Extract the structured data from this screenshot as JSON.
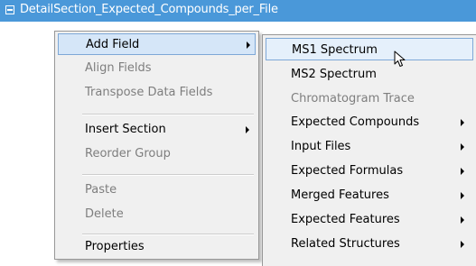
{
  "section": {
    "title": "DetailSection_Expected_Compounds_per_File"
  },
  "menu": {
    "items": [
      {
        "label": "Add Field",
        "enabled": true,
        "submenu": true,
        "highlighted": true
      },
      {
        "label": "Align Fields",
        "enabled": false,
        "submenu": false
      },
      {
        "label": "Transpose Data Fields",
        "enabled": false,
        "submenu": false
      },
      {
        "label": "Insert Section",
        "enabled": true,
        "submenu": true
      },
      {
        "label": "Reorder Group",
        "enabled": false,
        "submenu": false
      },
      {
        "label": "Paste",
        "enabled": false,
        "submenu": false
      },
      {
        "label": "Delete",
        "enabled": false,
        "submenu": false
      },
      {
        "label": "Properties",
        "enabled": true,
        "submenu": false
      }
    ]
  },
  "submenu": {
    "items": [
      {
        "label": "MS1 Spectrum",
        "enabled": true,
        "submenu": false,
        "highlighted": true
      },
      {
        "label": "MS2 Spectrum",
        "enabled": true,
        "submenu": false
      },
      {
        "label": "Chromatogram Trace",
        "enabled": false,
        "submenu": false
      },
      {
        "label": "Expected Compounds",
        "enabled": true,
        "submenu": true
      },
      {
        "label": "Input Files",
        "enabled": true,
        "submenu": true
      },
      {
        "label": "Expected Formulas",
        "enabled": true,
        "submenu": true
      },
      {
        "label": "Merged Features",
        "enabled": true,
        "submenu": true
      },
      {
        "label": "Expected Features",
        "enabled": true,
        "submenu": true
      },
      {
        "label": "Related Structures",
        "enabled": true,
        "submenu": true
      }
    ]
  },
  "colors": {
    "header": "#4a98d9",
    "menu_bg": "#f0f0f0",
    "highlight": "#d5e6f8",
    "highlight_border": "#7ea8d7",
    "disabled_text": "#7e7e7e"
  }
}
